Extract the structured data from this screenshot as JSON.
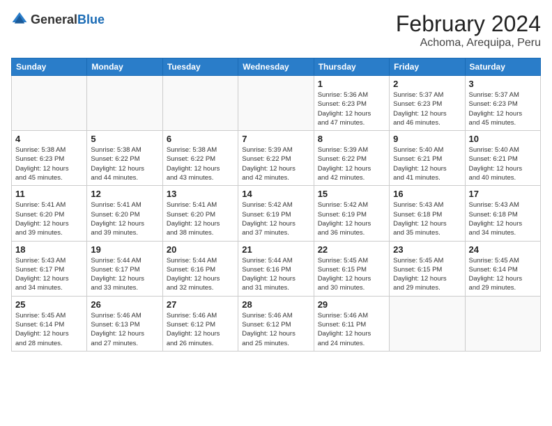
{
  "header": {
    "logo_general": "General",
    "logo_blue": "Blue",
    "month_year": "February 2024",
    "location": "Achoma, Arequipa, Peru"
  },
  "weekdays": [
    "Sunday",
    "Monday",
    "Tuesday",
    "Wednesday",
    "Thursday",
    "Friday",
    "Saturday"
  ],
  "weeks": [
    [
      {
        "day": "",
        "info": ""
      },
      {
        "day": "",
        "info": ""
      },
      {
        "day": "",
        "info": ""
      },
      {
        "day": "",
        "info": ""
      },
      {
        "day": "1",
        "info": "Sunrise: 5:36 AM\nSunset: 6:23 PM\nDaylight: 12 hours\nand 47 minutes."
      },
      {
        "day": "2",
        "info": "Sunrise: 5:37 AM\nSunset: 6:23 PM\nDaylight: 12 hours\nand 46 minutes."
      },
      {
        "day": "3",
        "info": "Sunrise: 5:37 AM\nSunset: 6:23 PM\nDaylight: 12 hours\nand 45 minutes."
      }
    ],
    [
      {
        "day": "4",
        "info": "Sunrise: 5:38 AM\nSunset: 6:23 PM\nDaylight: 12 hours\nand 45 minutes."
      },
      {
        "day": "5",
        "info": "Sunrise: 5:38 AM\nSunset: 6:22 PM\nDaylight: 12 hours\nand 44 minutes."
      },
      {
        "day": "6",
        "info": "Sunrise: 5:38 AM\nSunset: 6:22 PM\nDaylight: 12 hours\nand 43 minutes."
      },
      {
        "day": "7",
        "info": "Sunrise: 5:39 AM\nSunset: 6:22 PM\nDaylight: 12 hours\nand 42 minutes."
      },
      {
        "day": "8",
        "info": "Sunrise: 5:39 AM\nSunset: 6:22 PM\nDaylight: 12 hours\nand 42 minutes."
      },
      {
        "day": "9",
        "info": "Sunrise: 5:40 AM\nSunset: 6:21 PM\nDaylight: 12 hours\nand 41 minutes."
      },
      {
        "day": "10",
        "info": "Sunrise: 5:40 AM\nSunset: 6:21 PM\nDaylight: 12 hours\nand 40 minutes."
      }
    ],
    [
      {
        "day": "11",
        "info": "Sunrise: 5:41 AM\nSunset: 6:20 PM\nDaylight: 12 hours\nand 39 minutes."
      },
      {
        "day": "12",
        "info": "Sunrise: 5:41 AM\nSunset: 6:20 PM\nDaylight: 12 hours\nand 39 minutes."
      },
      {
        "day": "13",
        "info": "Sunrise: 5:41 AM\nSunset: 6:20 PM\nDaylight: 12 hours\nand 38 minutes."
      },
      {
        "day": "14",
        "info": "Sunrise: 5:42 AM\nSunset: 6:19 PM\nDaylight: 12 hours\nand 37 minutes."
      },
      {
        "day": "15",
        "info": "Sunrise: 5:42 AM\nSunset: 6:19 PM\nDaylight: 12 hours\nand 36 minutes."
      },
      {
        "day": "16",
        "info": "Sunrise: 5:43 AM\nSunset: 6:18 PM\nDaylight: 12 hours\nand 35 minutes."
      },
      {
        "day": "17",
        "info": "Sunrise: 5:43 AM\nSunset: 6:18 PM\nDaylight: 12 hours\nand 34 minutes."
      }
    ],
    [
      {
        "day": "18",
        "info": "Sunrise: 5:43 AM\nSunset: 6:17 PM\nDaylight: 12 hours\nand 34 minutes."
      },
      {
        "day": "19",
        "info": "Sunrise: 5:44 AM\nSunset: 6:17 PM\nDaylight: 12 hours\nand 33 minutes."
      },
      {
        "day": "20",
        "info": "Sunrise: 5:44 AM\nSunset: 6:16 PM\nDaylight: 12 hours\nand 32 minutes."
      },
      {
        "day": "21",
        "info": "Sunrise: 5:44 AM\nSunset: 6:16 PM\nDaylight: 12 hours\nand 31 minutes."
      },
      {
        "day": "22",
        "info": "Sunrise: 5:45 AM\nSunset: 6:15 PM\nDaylight: 12 hours\nand 30 minutes."
      },
      {
        "day": "23",
        "info": "Sunrise: 5:45 AM\nSunset: 6:15 PM\nDaylight: 12 hours\nand 29 minutes."
      },
      {
        "day": "24",
        "info": "Sunrise: 5:45 AM\nSunset: 6:14 PM\nDaylight: 12 hours\nand 29 minutes."
      }
    ],
    [
      {
        "day": "25",
        "info": "Sunrise: 5:45 AM\nSunset: 6:14 PM\nDaylight: 12 hours\nand 28 minutes."
      },
      {
        "day": "26",
        "info": "Sunrise: 5:46 AM\nSunset: 6:13 PM\nDaylight: 12 hours\nand 27 minutes."
      },
      {
        "day": "27",
        "info": "Sunrise: 5:46 AM\nSunset: 6:12 PM\nDaylight: 12 hours\nand 26 minutes."
      },
      {
        "day": "28",
        "info": "Sunrise: 5:46 AM\nSunset: 6:12 PM\nDaylight: 12 hours\nand 25 minutes."
      },
      {
        "day": "29",
        "info": "Sunrise: 5:46 AM\nSunset: 6:11 PM\nDaylight: 12 hours\nand 24 minutes."
      },
      {
        "day": "",
        "info": ""
      },
      {
        "day": "",
        "info": ""
      }
    ]
  ]
}
